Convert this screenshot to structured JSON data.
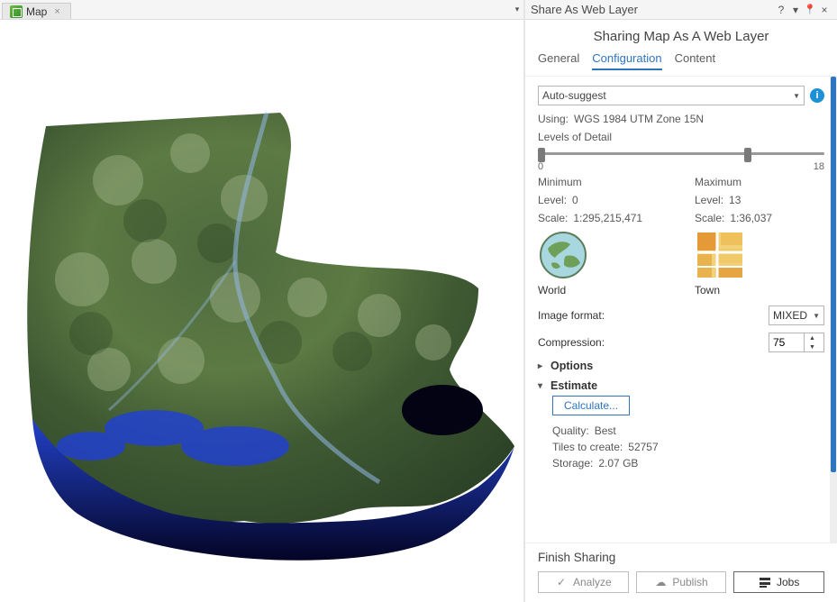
{
  "map_panel": {
    "tab_label": "Map"
  },
  "panel": {
    "title": "Share As Web Layer",
    "subtitle": "Sharing Map As A Web Layer",
    "tabs": [
      "General",
      "Configuration",
      "Content"
    ],
    "active_tab": "Configuration"
  },
  "config": {
    "dropdown_value": "Auto-suggest",
    "using_label": "Using:",
    "using_value": "WGS 1984 UTM Zone 15N",
    "lod_label": "Levels of Detail",
    "lod_min_tick": "0",
    "lod_max_tick": "18",
    "minimum": {
      "heading": "Minimum",
      "level_label": "Level:",
      "level_value": "0",
      "scale_label": "Scale:",
      "scale_value": "1:295,215,471",
      "caption": "World"
    },
    "maximum": {
      "heading": "Maximum",
      "level_label": "Level:",
      "level_value": "13",
      "scale_label": "Scale:",
      "scale_value": "1:36,037",
      "caption": "Town"
    },
    "image_format_label": "Image format:",
    "image_format_value": "MIXED",
    "compression_label": "Compression:",
    "compression_value": "75",
    "options_label": "Options",
    "estimate_label": "Estimate",
    "calculate_label": "Calculate...",
    "quality_label": "Quality:",
    "quality_value": "Best",
    "tiles_label": "Tiles to create:",
    "tiles_value": "52757",
    "storage_label": "Storage:",
    "storage_value": "2.07 GB"
  },
  "footer": {
    "heading": "Finish Sharing",
    "analyze": "Analyze",
    "publish": "Publish",
    "jobs": "Jobs"
  }
}
